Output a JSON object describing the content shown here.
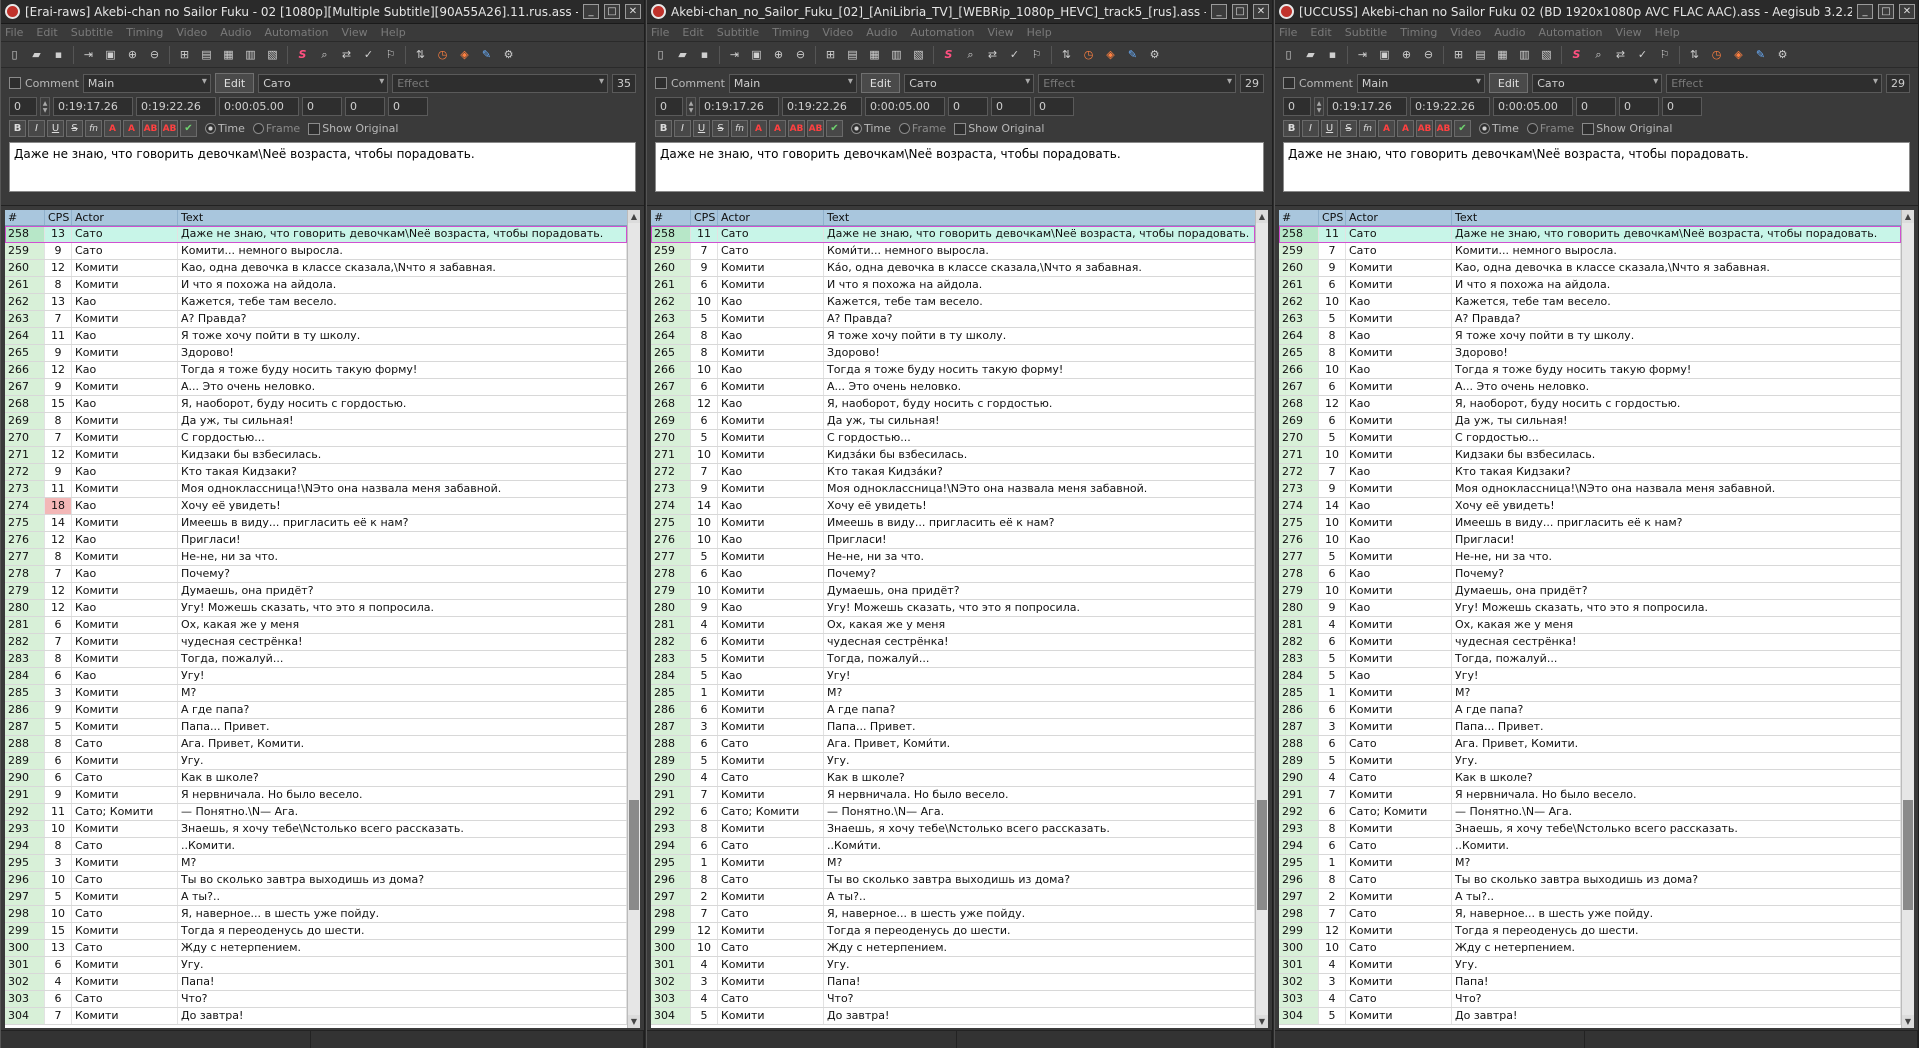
{
  "menu": [
    "File",
    "Edit",
    "Subtitle",
    "Timing",
    "Video",
    "Audio",
    "Automation",
    "View",
    "Help"
  ],
  "window_buttons": {
    "minimize": "_",
    "maximize": "□",
    "close": "✕"
  },
  "labels": {
    "comment": "Comment",
    "edit": "Edit",
    "time": "Time",
    "frame": "Frame",
    "show_original": "Show Original",
    "effect_placeholder": "Effect"
  },
  "columns": {
    "num": "#",
    "cps": "CPS",
    "actor": "Actor",
    "text": "Text"
  },
  "icon_names": [
    "new-file-icon",
    "open-file-icon",
    "save-icon",
    "export-icon",
    "jump-to-video-icon",
    "zoom-in-icon",
    "zoom-out-icon",
    "video-details-icon",
    "style-manager-icon",
    "attachments-icon",
    "fonts-collector-icon",
    "properties-icon",
    "automation-icon",
    "find-icon",
    "replace-icon",
    "spellcheck-icon",
    "translation-assistant-icon",
    "resample-icon",
    "timing-postprocessor-icon",
    "kanji-timer-icon",
    "visual-typesetting-icon",
    "options-icon"
  ],
  "editor": {
    "style": "Main",
    "actor": "Сато",
    "layer": "0",
    "start": "0:19:17.26",
    "end": "0:19:22.26",
    "duration": "0:00:05.00",
    "margin_l": "0",
    "margin_r": "0",
    "margin_v": "0",
    "text": "Даже не знаю, что говорить девочкам\\Nеё возраста, чтобы порадовать."
  },
  "windows": [
    {
      "title": "[Erai-raws] Akebi-chan no Sailor Fuku - 02 [1080p][Multiple Subtitle][90A55A26].11.rus.ass - Aegisub 3.2.2",
      "line_length": "35",
      "cps": [
        "13",
        "9",
        "12",
        "8",
        "13",
        "7",
        "11",
        "9",
        "12",
        "9",
        "15",
        "8",
        "7",
        "12",
        "9",
        "11",
        "18",
        "14",
        "12",
        "8",
        "7",
        "12",
        "12",
        "6",
        "7",
        "8",
        "6",
        "3",
        "9",
        "5",
        "8",
        "6",
        "6",
        "9",
        "11",
        "10",
        "8",
        "3",
        "10",
        "5",
        "10",
        "15",
        "13",
        "6",
        "4",
        "6",
        "7"
      ],
      "highlight_cps_row": 16,
      "rows": [
        [
          "258",
          "Сато",
          "Даже не знаю, что говорить девочкам\\Nеё возраста, чтобы порадовать."
        ],
        [
          "259",
          "Сато",
          "Комити... немного выросла."
        ],
        [
          "260",
          "Комити",
          "Као, одна девочка в классе сказала,\\Nчто я забавная."
        ],
        [
          "261",
          "Комити",
          "И что я похожа на айдола."
        ],
        [
          "262",
          "Као",
          "Кажется, тебе там весело."
        ],
        [
          "263",
          "Комити",
          "А? Правда?"
        ],
        [
          "264",
          "Као",
          "Я тоже хочу пойти в ту школу."
        ],
        [
          "265",
          "Комити",
          "Здорово!"
        ],
        [
          "266",
          "Као",
          "Тогда я тоже буду носить такую форму!"
        ],
        [
          "267",
          "Комити",
          "А... Это очень неловко."
        ],
        [
          "268",
          "Као",
          "Я, наоборот, буду носить с гордостью."
        ],
        [
          "269",
          "Комити",
          "Да уж, ты сильная!"
        ],
        [
          "270",
          "Комити",
          "С гордостью..."
        ],
        [
          "271",
          "Комити",
          "Кидзаки бы взбесилась."
        ],
        [
          "272",
          "Као",
          "Кто такая Кидзаки?"
        ],
        [
          "273",
          "Комити",
          "Моя одноклассница!\\NЭто она назвала меня забавной."
        ],
        [
          "274",
          "Као",
          "Хочу её увидеть!"
        ],
        [
          "275",
          "Комити",
          "Имеешь в виду... пригласить её к нам?"
        ],
        [
          "276",
          "Као",
          "Пригласи!"
        ],
        [
          "277",
          "Комити",
          "Не-не, ни за что."
        ],
        [
          "278",
          "Као",
          "Почему?"
        ],
        [
          "279",
          "Комити",
          "Думаешь, она придёт?"
        ],
        [
          "280",
          "Као",
          "Угу! Можешь сказать, что это я попросила."
        ],
        [
          "281",
          "Комити",
          "Ох, какая же у меня"
        ],
        [
          "282",
          "Комити",
          "чудесная сестрёнка!"
        ],
        [
          "283",
          "Комити",
          "Тогда, пожалуй..."
        ],
        [
          "284",
          "Као",
          "Угу!"
        ],
        [
          "285",
          "Комити",
          "М?"
        ],
        [
          "286",
          "Комити",
          "А где папа?"
        ],
        [
          "287",
          "Комити",
          "Папа... Привет."
        ],
        [
          "288",
          "Сато",
          "Ага. Привет, Комити."
        ],
        [
          "289",
          "Комити",
          "Угу."
        ],
        [
          "290",
          "Сато",
          "Как в школе?"
        ],
        [
          "291",
          "Комити",
          "Я нервничала. Но было весело."
        ],
        [
          "292",
          "Сато; Комити",
          "— Понятно.\\N— Ага."
        ],
        [
          "293",
          "Комити",
          "Знаешь, я хочу тебе\\Nстолько всего рассказать."
        ],
        [
          "294",
          "Сато",
          "..Комити."
        ],
        [
          "295",
          "Комити",
          "М?"
        ],
        [
          "296",
          "Сато",
          "Ты во сколько завтра выходишь из дома?"
        ],
        [
          "297",
          "Комити",
          "А ты?.."
        ],
        [
          "298",
          "Сато",
          "Я, наверное... в шесть уже пойду."
        ],
        [
          "299",
          "Комити",
          "Тогда я переоденусь до шести."
        ],
        [
          "300",
          "Сато",
          "Жду с нетерпением."
        ],
        [
          "301",
          "Комити",
          "Угу."
        ],
        [
          "302",
          "Комити",
          "Папа!"
        ],
        [
          "303",
          "Сато",
          "Что?"
        ],
        [
          "304",
          "Комити",
          "До завтра!"
        ]
      ]
    },
    {
      "title": "Akebi-chan_no_Sailor_Fuku_[02]_[AniLibria_TV]_[WEBRip_1080p_HEVC]_track5_[rus].ass - Aegisub 3.2.2",
      "line_length": "29",
      "cps": [
        "11",
        "7",
        "9",
        "6",
        "10",
        "5",
        "8",
        "8",
        "10",
        "6",
        "12",
        "6",
        "5",
        "10",
        "7",
        "9",
        "14",
        "10",
        "10",
        "5",
        "6",
        "10",
        "9",
        "4",
        "6",
        "5",
        "5",
        "1",
        "6",
        "3",
        "6",
        "5",
        "4",
        "7",
        "6",
        "8",
        "6",
        "1",
        "8",
        "2",
        "7",
        "12",
        "10",
        "4",
        "3",
        "4",
        "5"
      ],
      "highlight_cps_row": -1,
      "rows": [
        [
          "258",
          "Сато",
          "Даже не знаю, что говорить девочкам\\Nеё возраста, чтобы порадовать."
        ],
        [
          "259",
          "Сато",
          "Коми́ти... немного выросла."
        ],
        [
          "260",
          "Комити",
          "Ка́о, одна девочка в классе сказала,\\Nчто я забавная."
        ],
        [
          "261",
          "Комити",
          "И что я похожа на айдола."
        ],
        [
          "262",
          "Као",
          "Кажется, тебе там весело."
        ],
        [
          "263",
          "Комити",
          "А? Правда?"
        ],
        [
          "264",
          "Као",
          "Я тоже хочу пойти в ту школу."
        ],
        [
          "265",
          "Комити",
          "Здорово!"
        ],
        [
          "266",
          "Као",
          "Тогда я тоже буду носить такую форму!"
        ],
        [
          "267",
          "Комити",
          "А... Это очень неловко."
        ],
        [
          "268",
          "Као",
          "Я, наоборот, буду носить с гордостью."
        ],
        [
          "269",
          "Комити",
          "Да уж, ты сильная!"
        ],
        [
          "270",
          "Комити",
          "С гордостью..."
        ],
        [
          "271",
          "Комити",
          "Кидза́ки бы взбесилась."
        ],
        [
          "272",
          "Као",
          "Кто такая Кидза́ки?"
        ],
        [
          "273",
          "Комити",
          "Моя одноклассница!\\NЭто она назвала меня забавной."
        ],
        [
          "274",
          "Као",
          "Хочу её увидеть!"
        ],
        [
          "275",
          "Комити",
          "Имеешь в виду... пригласить её к нам?"
        ],
        [
          "276",
          "Као",
          "Пригласи!"
        ],
        [
          "277",
          "Комити",
          "Не-не, ни за что."
        ],
        [
          "278",
          "Као",
          "Почему?"
        ],
        [
          "279",
          "Комити",
          "Думаешь, она придёт?"
        ],
        [
          "280",
          "Као",
          "Угу! Можешь сказать, что это я попросила."
        ],
        [
          "281",
          "Комити",
          "Ох, какая же у меня"
        ],
        [
          "282",
          "Комити",
          "чудесная сестрёнка!"
        ],
        [
          "283",
          "Комити",
          "Тогда, пожалуй..."
        ],
        [
          "284",
          "Као",
          "Угу!"
        ],
        [
          "285",
          "Комити",
          "М?"
        ],
        [
          "286",
          "Комити",
          "А где папа?"
        ],
        [
          "287",
          "Комити",
          "Папа... Привет."
        ],
        [
          "288",
          "Сато",
          "Ага. Привет, Коми́ти."
        ],
        [
          "289",
          "Комити",
          "Угу."
        ],
        [
          "290",
          "Сато",
          "Как в школе?"
        ],
        [
          "291",
          "Комити",
          "Я нервничала. Но было весело."
        ],
        [
          "292",
          "Сато; Комити",
          "— Понятно.\\N— Ага."
        ],
        [
          "293",
          "Комити",
          "Знаешь, я хочу тебе\\Nстолько всего рассказать."
        ],
        [
          "294",
          "Сато",
          "..Коми́ти."
        ],
        [
          "295",
          "Комити",
          "М?"
        ],
        [
          "296",
          "Сато",
          "Ты во сколько завтра выходишь из дома?"
        ],
        [
          "297",
          "Комити",
          "А ты?.."
        ],
        [
          "298",
          "Сато",
          "Я, наверное... в шесть уже пойду."
        ],
        [
          "299",
          "Комити",
          "Тогда я переоденусь до шести."
        ],
        [
          "300",
          "Сато",
          "Жду с нетерпением."
        ],
        [
          "301",
          "Комити",
          "Угу."
        ],
        [
          "302",
          "Комити",
          "Папа!"
        ],
        [
          "303",
          "Сато",
          "Что?"
        ],
        [
          "304",
          "Комити",
          "До завтра!"
        ]
      ]
    },
    {
      "title": "[UCCUSS] Akebi-chan no Sailor Fuku 02 (BD 1920x1080p AVC FLAC AAC).ass - Aegisub 3.2.2",
      "line_length": "29",
      "cps": [
        "11",
        "7",
        "9",
        "6",
        "10",
        "5",
        "8",
        "8",
        "10",
        "6",
        "12",
        "6",
        "5",
        "10",
        "7",
        "9",
        "14",
        "10",
        "10",
        "5",
        "6",
        "10",
        "9",
        "4",
        "6",
        "5",
        "5",
        "1",
        "6",
        "3",
        "6",
        "5",
        "4",
        "7",
        "6",
        "8",
        "6",
        "1",
        "8",
        "2",
        "7",
        "12",
        "10",
        "4",
        "3",
        "4",
        "5"
      ],
      "highlight_cps_row": -1,
      "rows": [
        [
          "258",
          "Сато",
          "Даже не знаю, что говорить девочкам\\Nеё возраста, чтобы порадовать."
        ],
        [
          "259",
          "Сато",
          "Комити... немного выросла."
        ],
        [
          "260",
          "Комити",
          "Као, одна девочка в классе сказала,\\Nчто я забавная."
        ],
        [
          "261",
          "Комити",
          "И что я похожа на айдола."
        ],
        [
          "262",
          "Као",
          "Кажется, тебе там весело."
        ],
        [
          "263",
          "Комити",
          "А? Правда?"
        ],
        [
          "264",
          "Као",
          "Я тоже хочу пойти в ту школу."
        ],
        [
          "265",
          "Комити",
          "Здорово!"
        ],
        [
          "266",
          "Као",
          "Тогда я тоже буду носить такую форму!"
        ],
        [
          "267",
          "Комити",
          "А... Это очень неловко."
        ],
        [
          "268",
          "Као",
          "Я, наоборот, буду носить с гордостью."
        ],
        [
          "269",
          "Комити",
          "Да уж, ты сильная!"
        ],
        [
          "270",
          "Комити",
          "С гордостью..."
        ],
        [
          "271",
          "Комити",
          "Кидзаки бы взбесилась."
        ],
        [
          "272",
          "Као",
          "Кто такая Кидзаки?"
        ],
        [
          "273",
          "Комити",
          "Моя одноклассница!\\NЭто она назвала меня забавной."
        ],
        [
          "274",
          "Као",
          "Хочу её увидеть!"
        ],
        [
          "275",
          "Комити",
          "Имеешь в виду... пригласить её к нам?"
        ],
        [
          "276",
          "Као",
          "Пригласи!"
        ],
        [
          "277",
          "Комити",
          "Не-не, ни за что."
        ],
        [
          "278",
          "Као",
          "Почему?"
        ],
        [
          "279",
          "Комити",
          "Думаешь, она придёт?"
        ],
        [
          "280",
          "Као",
          "Угу! Можешь сказать, что это я попросила."
        ],
        [
          "281",
          "Комити",
          "Ох, какая же у меня"
        ],
        [
          "282",
          "Комити",
          "чудесная сестрёнка!"
        ],
        [
          "283",
          "Комити",
          "Тогда, пожалуй..."
        ],
        [
          "284",
          "Као",
          "Угу!"
        ],
        [
          "285",
          "Комити",
          "М?"
        ],
        [
          "286",
          "Комити",
          "А где папа?"
        ],
        [
          "287",
          "Комити",
          "Папа... Привет."
        ],
        [
          "288",
          "Сато",
          "Ага. Привет, Комити."
        ],
        [
          "289",
          "Комити",
          "Угу."
        ],
        [
          "290",
          "Сато",
          "Как в школе?"
        ],
        [
          "291",
          "Комити",
          "Я нервничала. Но было весело."
        ],
        [
          "292",
          "Сато; Комити",
          "— Понятно.\\N— Ага."
        ],
        [
          "293",
          "Комити",
          "Знаешь, я хочу тебе\\Nстолько всего рассказать."
        ],
        [
          "294",
          "Сато",
          "..Комити."
        ],
        [
          "295",
          "Комити",
          "М?"
        ],
        [
          "296",
          "Сато",
          "Ты во сколько завтра выходишь из дома?"
        ],
        [
          "297",
          "Комити",
          "А ты?.."
        ],
        [
          "298",
          "Сато",
          "Я, наверное... в шесть уже пойду."
        ],
        [
          "299",
          "Комити",
          "Тогда я переоденусь до шести."
        ],
        [
          "300",
          "Сато",
          "Жду с нетерпением."
        ],
        [
          "301",
          "Комити",
          "Угу."
        ],
        [
          "302",
          "Комити",
          "Папа!"
        ],
        [
          "303",
          "Сато",
          "Что?"
        ],
        [
          "304",
          "Комити",
          "До завтра!"
        ]
      ]
    }
  ]
}
